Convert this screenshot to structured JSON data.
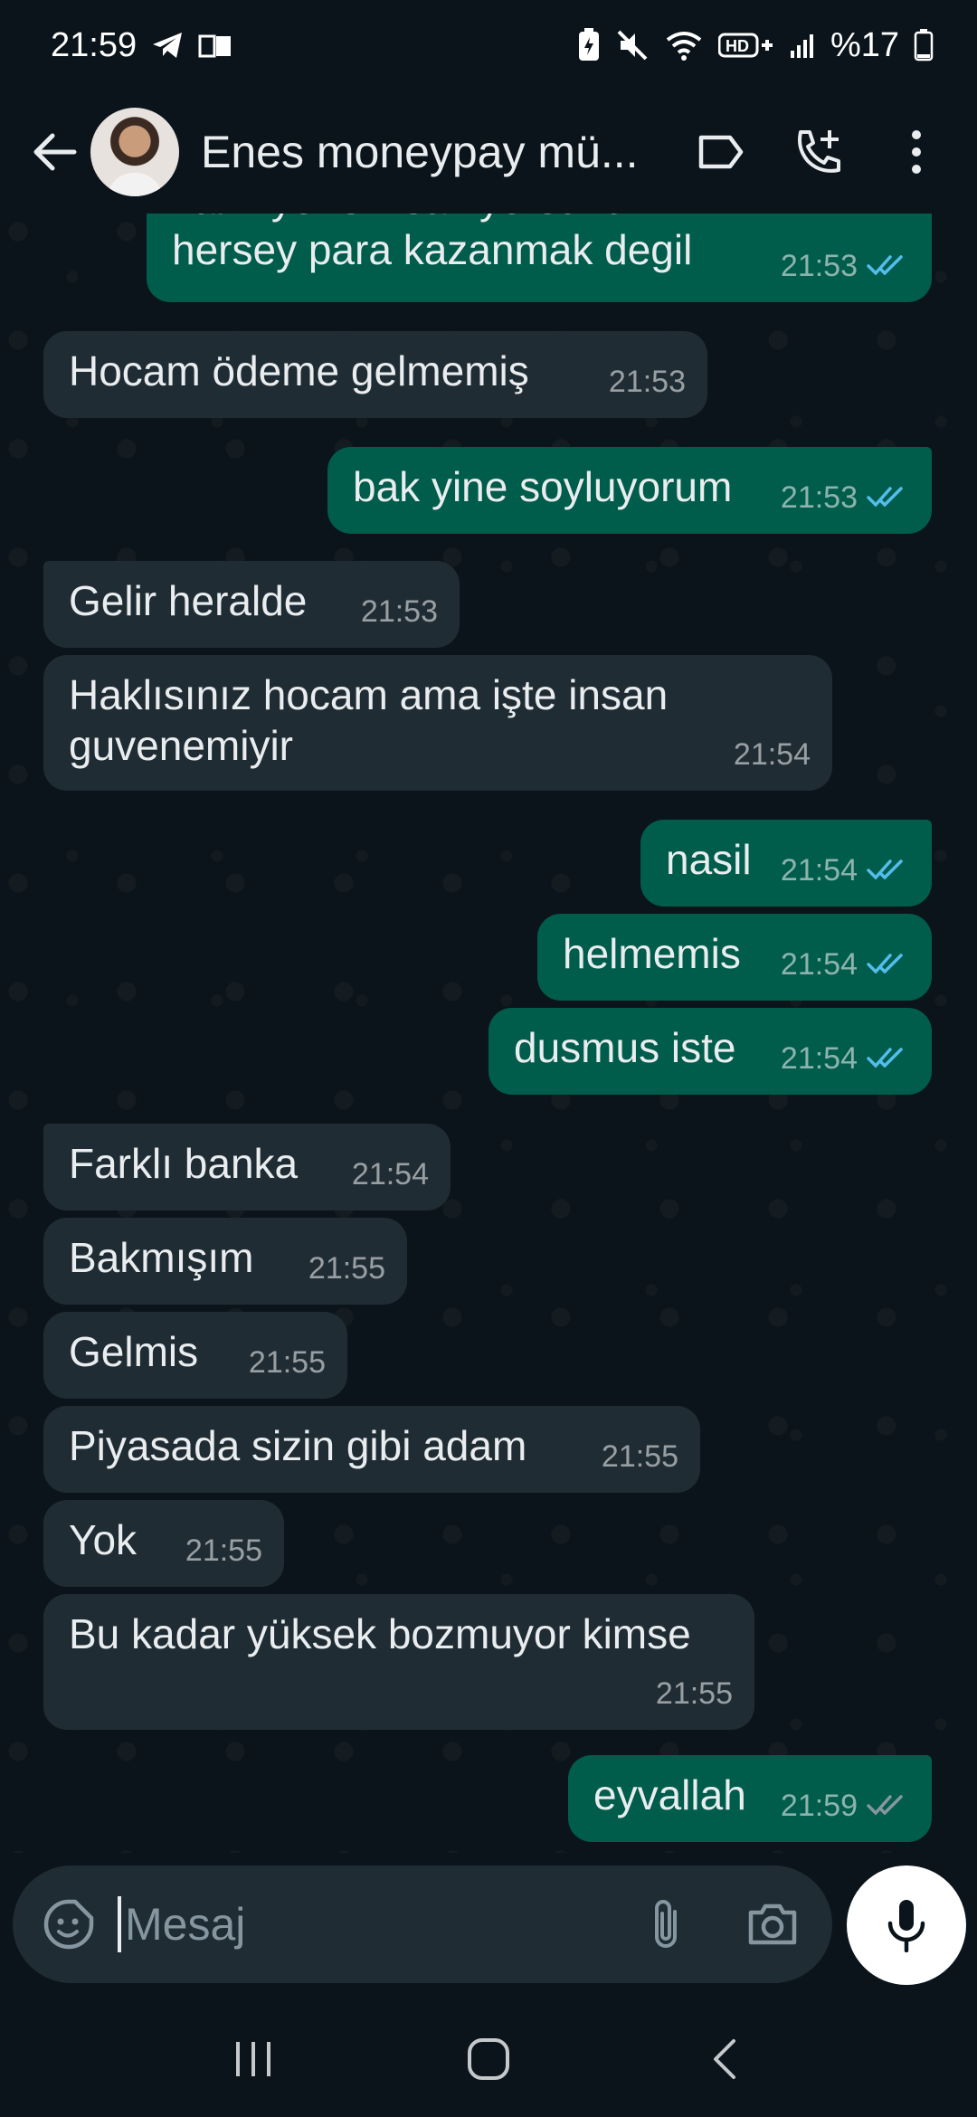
{
  "status_bar": {
    "time": "21:59",
    "battery_text": "%17",
    "icons": [
      "telegram-icon",
      "gallery-icon",
      "battery-saver-icon",
      "mute-icon",
      "wifi-icon",
      "hd-plus-icon",
      "signal-icon",
      "battery-icon"
    ]
  },
  "header": {
    "title": "Enes moneypay mü...",
    "back_icon": "arrow-back-icon",
    "label_icon": "label-icon",
    "call_icon": "add-call-icon",
    "menu_icon": "more-vert-icon"
  },
  "messages": [
    {
      "dir": "out",
      "text": "kalmıyor siz saniyorsunuz hersey para kazanmak degil",
      "time": "21:53",
      "status": "read"
    },
    {
      "dir": "in",
      "text": "Hocam ödeme gelmemiş",
      "time": "21:53"
    },
    {
      "dir": "out",
      "text": "bak yine soyluyorum",
      "time": "21:53",
      "status": "read"
    },
    {
      "dir": "in",
      "text": "Gelir heralde",
      "time": "21:53"
    },
    {
      "dir": "in",
      "text": "Haklısınız hocam ama işte insan guvenemiyir",
      "time": "21:54"
    },
    {
      "dir": "out",
      "text": "nasil",
      "time": "21:54",
      "status": "read"
    },
    {
      "dir": "out",
      "text": "helmemis",
      "time": "21:54",
      "status": "read"
    },
    {
      "dir": "out",
      "text": "dusmus iste",
      "time": "21:54",
      "status": "read"
    },
    {
      "dir": "in",
      "text": "Farklı banka",
      "time": "21:54"
    },
    {
      "dir": "in",
      "text": "Bakmışım",
      "time": "21:55"
    },
    {
      "dir": "in",
      "text": "Gelmis",
      "time": "21:55"
    },
    {
      "dir": "in",
      "text": "Piyasada sizin gibi adam",
      "time": "21:55"
    },
    {
      "dir": "in",
      "text": "Yok",
      "time": "21:55"
    },
    {
      "dir": "in",
      "text": "Bu kadar yüksek bozmuyor kimse",
      "time": "21:55"
    },
    {
      "dir": "out",
      "text": "eyvallah",
      "time": "21:59",
      "status": "delivered"
    }
  ],
  "input": {
    "placeholder": "Mesaj",
    "emoji_icon": "sticker-icon",
    "attach_icon": "paperclip-icon",
    "camera_icon": "camera-icon",
    "mic_icon": "mic-icon"
  },
  "colors": {
    "background": "#0b141a",
    "incoming_bubble": "#202c33",
    "outgoing_bubble": "#005c4b",
    "read_tick": "#53bdeb",
    "delivered_tick": "#8696a0"
  },
  "nav": {
    "icons": [
      "recent-apps-icon",
      "home-icon",
      "back-nav-icon"
    ]
  }
}
